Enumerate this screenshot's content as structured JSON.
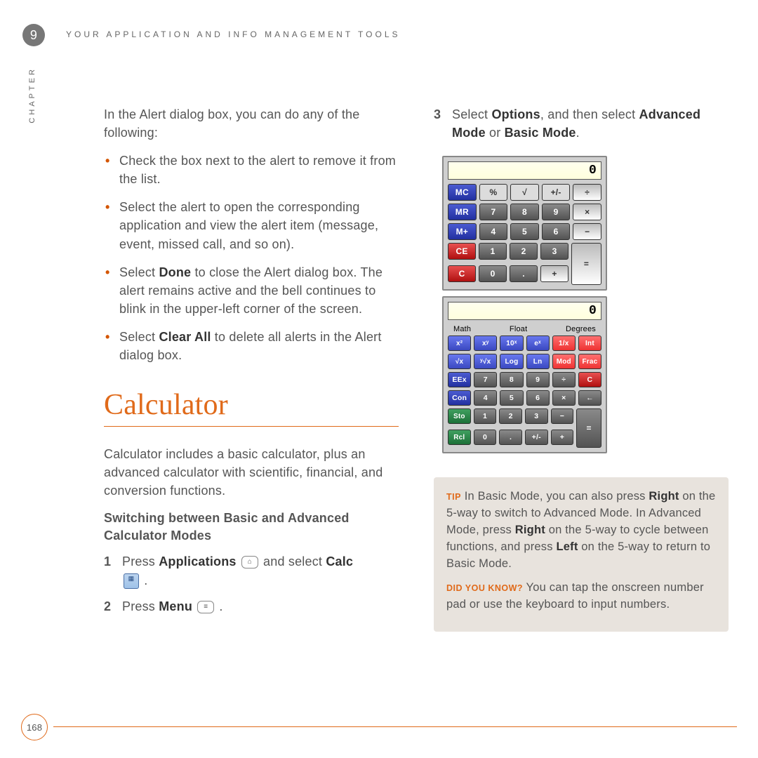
{
  "chapter_number": "9",
  "chapter_sidebar": "CHAPTER",
  "header": "YOUR APPLICATION AND INFO MANAGEMENT TOOLS",
  "page_number": "168",
  "col_left": {
    "intro": "In the Alert dialog box, you can do any of the following:",
    "bullets": [
      "Check the box next to the alert to remove it from the list.",
      "Select the alert to open the corresponding application and view the alert item (message, event, missed call, and so on).",
      {
        "pre": "Select ",
        "b1": "Done",
        "post": " to close the Alert dialog box. The alert remains active and the bell continues to blink in the upper-left corner of the screen."
      },
      {
        "pre": "Select ",
        "b1": "Clear All",
        "post": " to delete all alerts in the Alert dialog box."
      }
    ],
    "section_title": "Calculator",
    "section_intro": "Calculator includes a basic calculator, plus an advanced calculator with scientific, financial, and conversion functions.",
    "subsection": "Switching between Basic and Advanced Calculator Modes",
    "steps": [
      {
        "n": "1",
        "pre": "Press ",
        "b1": "Applications",
        "mid": " ",
        "icon1": "home-icon",
        "mid2": " and select ",
        "b2": "Calc",
        "icon2": "calc-icon",
        "post": " ."
      },
      {
        "n": "2",
        "pre": "Press ",
        "b1": "Menu",
        "mid": " ",
        "icon1": "menu-icon",
        "post": " ."
      }
    ]
  },
  "col_right": {
    "step3": {
      "n": "3",
      "pre": "Select ",
      "b1": "Options",
      "mid": ", and then select ",
      "b2": "Advanced Mode",
      "mid2": " or ",
      "b3": "Basic Mode",
      "post": "."
    },
    "basic_calc": {
      "display": "0",
      "rows": [
        [
          "MC",
          "%",
          "√",
          "+/-",
          "÷"
        ],
        [
          "MR",
          "7",
          "8",
          "9",
          "×"
        ],
        [
          "M+",
          "4",
          "5",
          "6",
          "−"
        ],
        [
          "CE",
          "1",
          "2",
          "3",
          "="
        ],
        [
          "C",
          "0",
          ".",
          "+"
        ]
      ]
    },
    "adv_calc": {
      "display": "0",
      "tabs": [
        "Math",
        "Float",
        "Degrees"
      ],
      "rows": [
        [
          "x²",
          "xʸ",
          "10ˣ",
          "eˣ",
          "1/x",
          "Int"
        ],
        [
          "√x",
          "ʸ√x",
          "Log",
          "Ln",
          "Mod",
          "Frac"
        ],
        [
          "EEx",
          "7",
          "8",
          "9",
          "÷",
          "C"
        ],
        [
          "Con",
          "4",
          "5",
          "6",
          "×",
          "←"
        ],
        [
          "Sto",
          "1",
          "2",
          "3",
          "−",
          "="
        ],
        [
          "Rcl",
          "0",
          ".",
          "+/-",
          "+"
        ]
      ]
    },
    "tip": {
      "label": "TIP",
      "text_pre": " In Basic Mode, you can also press ",
      "b1": "Right",
      "text_mid1": " on the 5-way to switch to Advanced Mode. In Advanced Mode, press ",
      "b2": "Right",
      "text_mid2": " on the 5-way to cycle between functions, and press ",
      "b3": "Left",
      "text_post": " on the 5-way to return to Basic Mode."
    },
    "dyk": {
      "label": "DID YOU KNOW?",
      "text": " You can tap the onscreen number pad or use the keyboard to input numbers."
    }
  }
}
